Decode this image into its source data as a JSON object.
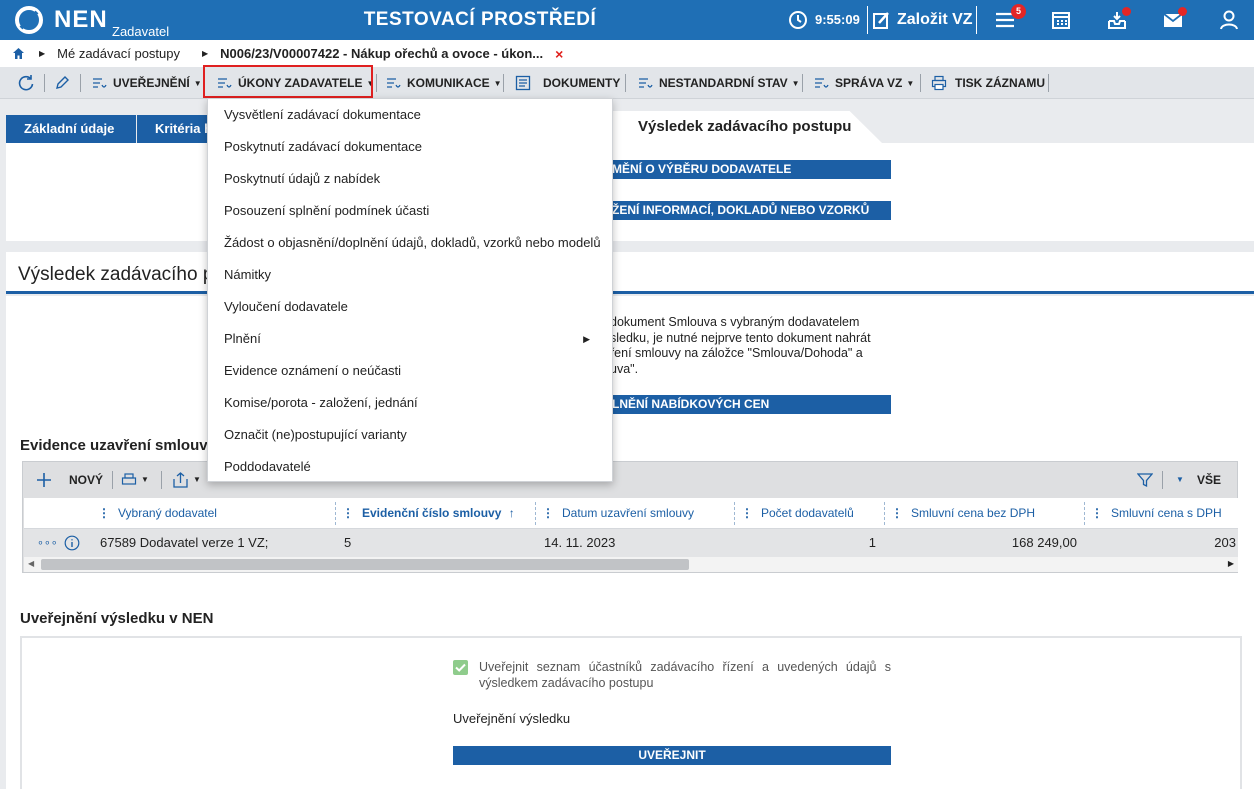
{
  "header": {
    "brand": "NEN",
    "brand_sub": "Zadavatel",
    "env_title": "TESTOVACÍ PROSTŘEDÍ",
    "time": "9:55:09",
    "create_label": "Založit VZ",
    "notifications_count": "5"
  },
  "breadcrumb": {
    "item1": "Mé zadávací postupy",
    "item2": "N006/23/V00007422 - Nákup ořechů a ovoce - úkon...",
    "close": "×"
  },
  "toolbar": {
    "uverejneni": "UVEŘEJNĚNÍ",
    "ukony": "ÚKONY ZADAVATELE",
    "komunikace": "KOMUNIKACE",
    "dokumenty": "DOKUMENTY",
    "nestandardni": "NESTANDARDNÍ STAV",
    "sprava": "SPRÁVA VZ",
    "tisk": "TISK ZÁZNAMU"
  },
  "tabs": {
    "t1": "Základní údaje",
    "t2": "Kritéria h",
    "active": "Výsledek zadávacího postupu"
  },
  "buttons": {
    "b1": "MĚNÍ O VÝBĚRU DODAVATELE",
    "b2": "ŽENÍ INFORMACÍ, DOKLADŮ NEBO VZORKŮ",
    "b3": "LNĚNÍ NABÍDKOVÝCH CEN",
    "publish": "UVEŘEJNIT"
  },
  "section": {
    "title": "Výsledek zadávacího po",
    "info_lines": [
      "dokument Smlouva s vybraným dodavatelem",
      "sledku, je nutné nejprve tento dokument nahrát",
      "ření smlouvy na záložce \"Smlouva/Dohoda\" a",
      "uva\"."
    ],
    "contracts_title": "Evidence uzavření smlouvy",
    "publication_title": "Uveřejnění výsledku v NEN",
    "publish_checkbox": "Uveřejnit seznam účastníků zadávacího řízení a uvedených údajů s výsledkem zadávacího postupu",
    "publish_result_label": "Uveřejnění výsledku"
  },
  "grid": {
    "new_label": "NOVÝ",
    "all_label": "VŠE",
    "columns": [
      "Vybraný dodavatel",
      "Evidenční číslo smlouvy",
      "Datum uzavření smlouvy",
      "Počet dodavatelů",
      "Smluvní cena bez DPH",
      "Smluvní cena s DPH"
    ],
    "sort_arrow": "↑",
    "row": {
      "dots": "∘∘∘",
      "supplier": "67589 Dodavatel verze 1 VZ;",
      "number": "5",
      "date": "14. 11. 2023",
      "count": "1",
      "price_no_vat": "168 249,00",
      "price_vat": "203"
    }
  },
  "menu": {
    "items": [
      "Vysvětlení zadávací dokumentace",
      "Poskytnutí zadávací dokumentace",
      "Poskytnutí údajů z nabídek",
      "Posouzení splnění podmínek účasti",
      "Žádost o objasnění/doplnění údajů, dokladů, vzorků nebo modelů",
      "Námitky",
      "Vyloučení dodavatele",
      "Plnění",
      "Evidence oznámení o neúčasti",
      "Komise/porota - založení, jednání",
      "Označit (ne)postupující varianty",
      "Poddodavatelé"
    ]
  },
  "colors": {
    "brand": "#1f6fb5",
    "dark_blue": "#1c5fa5",
    "highlight": "#e02020",
    "check": "#8fcc8c"
  }
}
